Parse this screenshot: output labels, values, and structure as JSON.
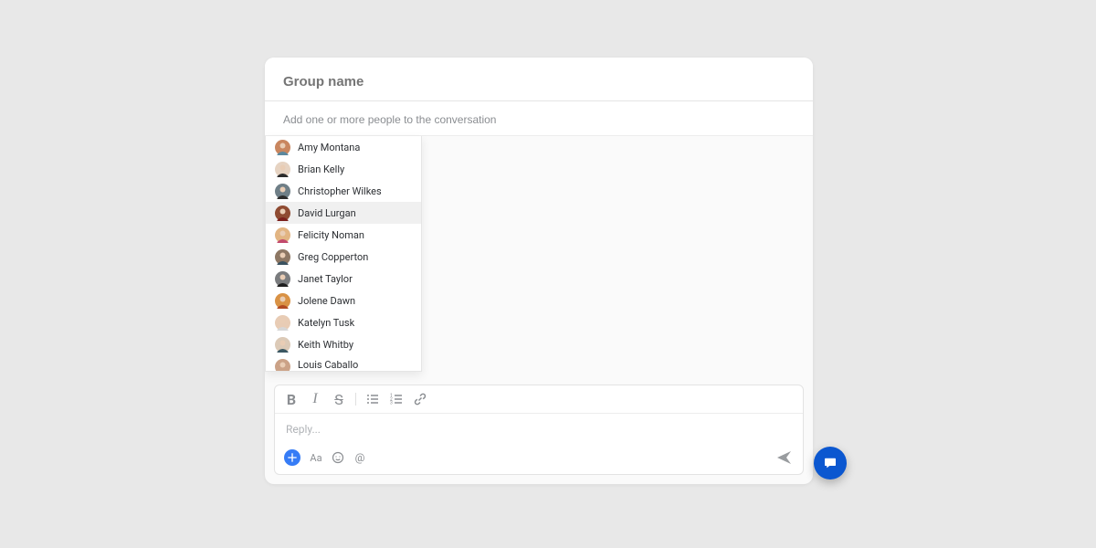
{
  "header": {
    "group_name_placeholder": "Group name"
  },
  "recipients": {
    "placeholder": "Add one or more people to the conversation"
  },
  "people": [
    {
      "name": "Amy Montana",
      "bg": "#c9865f",
      "shirt": "#5b889e"
    },
    {
      "name": "Brian Kelly",
      "bg": "#e6d3c2",
      "shirt": "#2b2b2b"
    },
    {
      "name": "Christopher Wilkes",
      "bg": "#6f7f87",
      "shirt": "#2b2b2b"
    },
    {
      "name": "David Lurgan",
      "bg": "#8f4b32",
      "shirt": "#7b1f1b",
      "hovered": true
    },
    {
      "name": "Felicity Noman",
      "bg": "#e2b583",
      "shirt": "#c24a6d"
    },
    {
      "name": "Greg Copperton",
      "bg": "#8d7764",
      "shirt": "#3a5260"
    },
    {
      "name": "Janet Taylor",
      "bg": "#7a7c7e",
      "shirt": "#1f1f1f"
    },
    {
      "name": "Jolene Dawn",
      "bg": "#d99245",
      "shirt": "#b24a23"
    },
    {
      "name": "Katelyn Tusk",
      "bg": "#e8ccb5",
      "shirt": "#d7d7d7"
    },
    {
      "name": "Keith Whitby",
      "bg": "#dccab7",
      "shirt": "#3a5762"
    },
    {
      "name": "Louis Caballo",
      "bg": "#cba287",
      "shirt": "#2f2f2f",
      "cut": true
    }
  ],
  "composer": {
    "reply_placeholder": "Reply...",
    "toolbar": {
      "bold": "B",
      "italic": "I",
      "strike": "S",
      "bulleted_list": "ul",
      "numbered_list": "ol",
      "link": "link"
    },
    "bottom": {
      "text_style": "Aa",
      "mention": "@"
    }
  },
  "colors": {
    "accent": "#367cf6",
    "fab": "#0b57d0"
  }
}
